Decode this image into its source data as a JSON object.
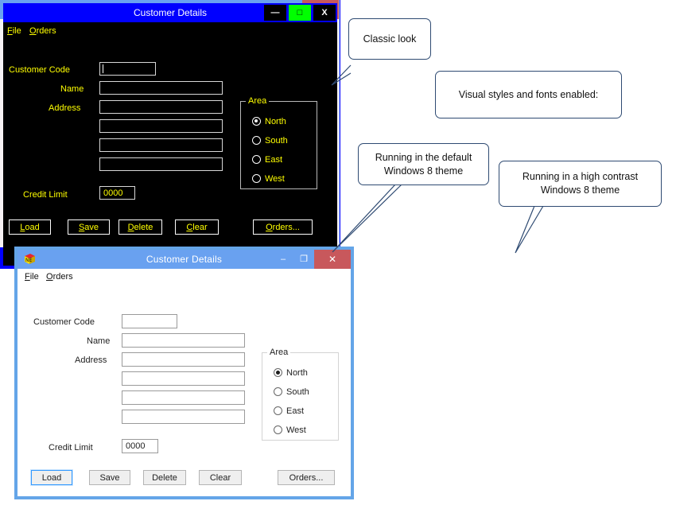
{
  "page": {
    "title": "Customer Details form rendered under three Windows themes",
    "accent_blue": "#69a1f0",
    "hc_blue": "#0000ff",
    "hc_yellow": "#ffff00",
    "hc_green": "#00ff00",
    "close_red": "#c8585c"
  },
  "form": {
    "title": "Customer Details",
    "icon": "ne-cube-icon",
    "menu": [
      {
        "label": "File",
        "accel": "F"
      },
      {
        "label": "Orders",
        "accel": "O"
      }
    ],
    "labels": {
      "customer_code": "Customer Code",
      "name": "Name",
      "address": "Address",
      "credit_limit": "Credit Limit"
    },
    "values": {
      "customer_code": "",
      "name": "",
      "address_1": "",
      "address_2": "",
      "address_3": "",
      "address_4": "",
      "credit_limit": "0000"
    },
    "group": {
      "title": "Area",
      "options": [
        {
          "label": "North",
          "selected": true
        },
        {
          "label": "South",
          "selected": false
        },
        {
          "label": "East",
          "selected": false
        },
        {
          "label": "West",
          "selected": false
        }
      ]
    },
    "buttons": [
      {
        "label": "Load",
        "accel": "L",
        "default": true
      },
      {
        "label": "Save",
        "accel": "S",
        "default": false
      },
      {
        "label": "Delete",
        "accel": "D",
        "default": false
      },
      {
        "label": "Clear",
        "accel": "C",
        "default": false
      },
      {
        "label": "Orders...",
        "accel": "O",
        "default": false
      }
    ],
    "window_buttons": {
      "minimize": "–",
      "maximize": "❐",
      "close": "✕"
    },
    "hc_window_buttons": {
      "minimize": "—",
      "maximize": "□",
      "close": "X"
    }
  },
  "callouts": [
    {
      "id": "classic",
      "text": "Classic look"
    },
    {
      "id": "visual-styles",
      "text": "Visual styles and fonts enabled:"
    },
    {
      "id": "default-theme",
      "text": "Running in the default Windows 8 theme"
    },
    {
      "id": "high-contrast",
      "text": "Running in a high contrast Windows 8 theme"
    }
  ]
}
